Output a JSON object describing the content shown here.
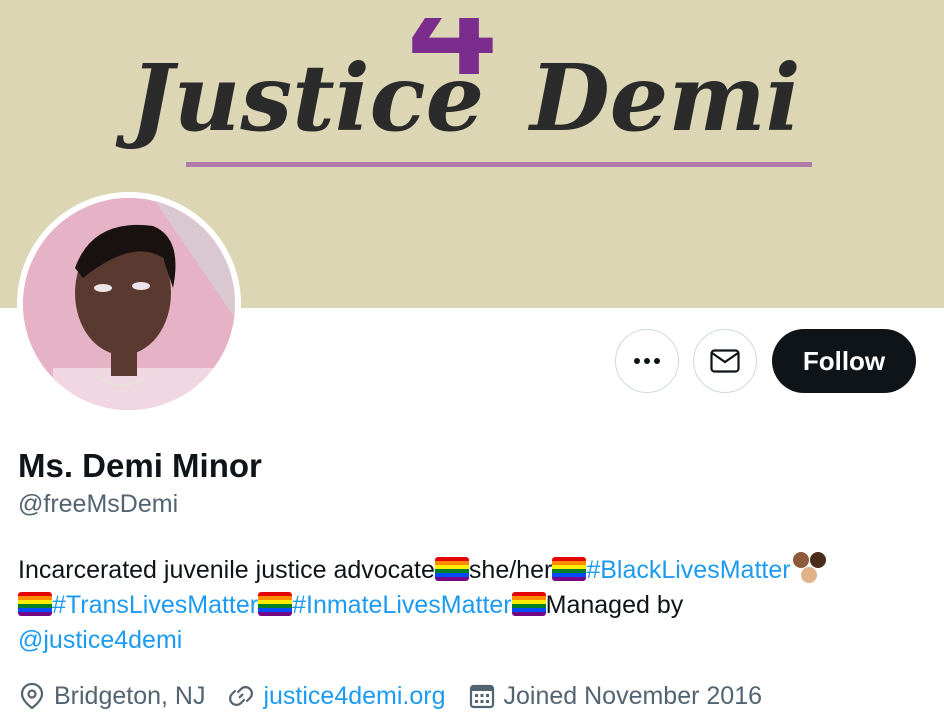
{
  "banner": {
    "logo_text_left": "Justice",
    "logo_digit": "4",
    "logo_text_right": "Demi",
    "bg_color": "#dcd6b4",
    "accent": "#7b2d8e"
  },
  "actions": {
    "more_icon": "ellipsis-icon",
    "message_icon": "envelope-icon",
    "follow_label": "Follow"
  },
  "profile": {
    "display_name": "Ms. Demi Minor",
    "handle": "@freeMsDemi",
    "bio": {
      "part1": "Incarcerated juvenile justice advocate",
      "part2": "she/her",
      "tag1": "#BlackLivesMatter",
      "tag2": "#TransLivesMatter",
      "tag3": "#InmateLivesMatter",
      "part3": "Managed by",
      "mention": "@justice4demi"
    },
    "location": "Bridgeton, NJ",
    "website": "justice4demi.org",
    "joined": "Joined November 2016"
  },
  "colors": {
    "link": "#1d9bf0",
    "muted": "#536471",
    "text": "#0f1419"
  }
}
